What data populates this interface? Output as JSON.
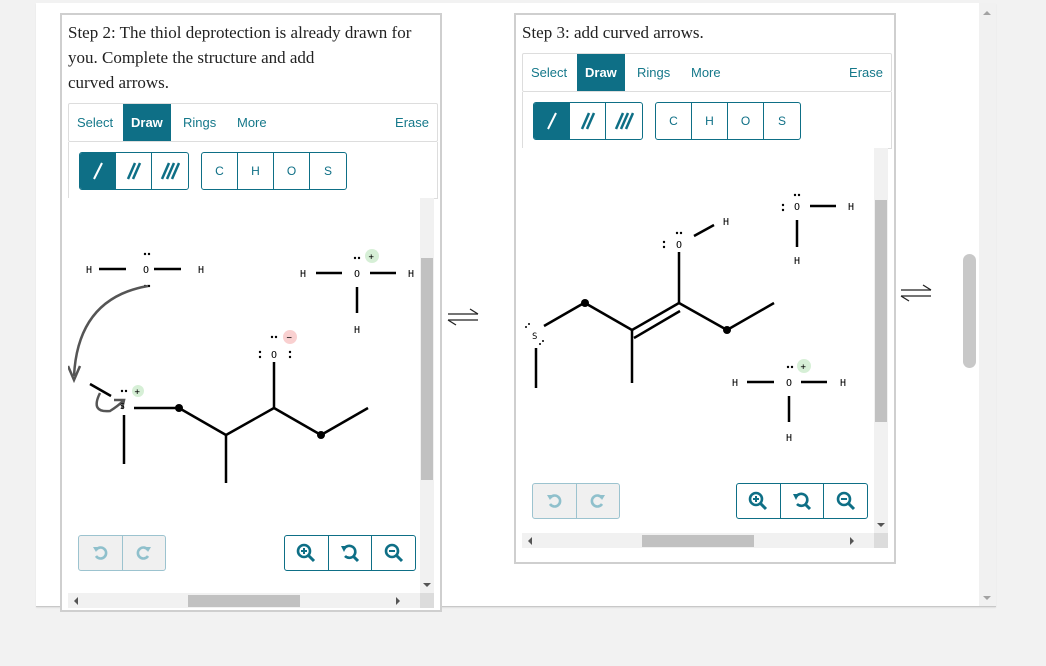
{
  "steps": [
    {
      "id": "step2",
      "prompt": "Step 2: The thiol deprotection is already drawn for you. Complete the structure and add curved arrows.",
      "prompt_lines": [
        "Step 2: The thiol deprotection is already drawn for",
        "you. Complete the structure and add",
        "curved arrows."
      ],
      "toolbar": {
        "select": "Select",
        "draw": "Draw",
        "rings": "Rings",
        "more": "More",
        "erase": "Erase",
        "active_tab": "Draw"
      },
      "atoms": [
        "C",
        "H",
        "O",
        "S"
      ],
      "bonds": [
        "single-bond",
        "double-bond",
        "triple-bond"
      ],
      "active_bond": "single-bond",
      "molecule_labels": {
        "water_h_left": "H",
        "water_o": "O",
        "water_h_right": "H",
        "hydronium_h_left": "H",
        "hydronium_o": "O",
        "hydronium_h_right": "H",
        "hydronium_h_bottom": "H",
        "alkoxide_o": "O",
        "sulfur": "S"
      },
      "charges": {
        "hydronium": "+",
        "alkoxide": "−",
        "sulfonium": "+"
      }
    },
    {
      "id": "step3",
      "prompt": "Step 3: add curved arrows.",
      "toolbar": {
        "select": "Select",
        "draw": "Draw",
        "rings": "Rings",
        "more": "More",
        "erase": "Erase",
        "active_tab": "Draw"
      },
      "atoms": [
        "C",
        "H",
        "O",
        "S"
      ],
      "bonds": [
        "single-bond",
        "double-bond",
        "triple-bond"
      ],
      "active_bond": "single-bond",
      "molecule_labels": {
        "sulfur": "S",
        "enol_o": "O",
        "enol_h": "H",
        "water_o": "O",
        "water_h_right": "H",
        "water_h_bottom": "H",
        "hydronium_h_left": "H",
        "hydronium_o": "O",
        "hydronium_h_right": "H",
        "hydronium_h_bottom": "H"
      },
      "charges": {
        "hydronium": "+"
      }
    }
  ],
  "equilibrium_arrows": [
    "⇌",
    "⇌"
  ],
  "icons": {
    "undo": "undo-icon",
    "redo": "redo-icon",
    "zoom_in": "zoom-in-icon",
    "zoom_reset": "zoom-reset-icon",
    "zoom_out": "zoom-out-icon"
  },
  "colors": {
    "accent": "#0e6f86",
    "positive_charge_bg": "#d6efd6",
    "negative_charge_bg": "#f9d0d0",
    "curved_arrow": "#555555"
  }
}
